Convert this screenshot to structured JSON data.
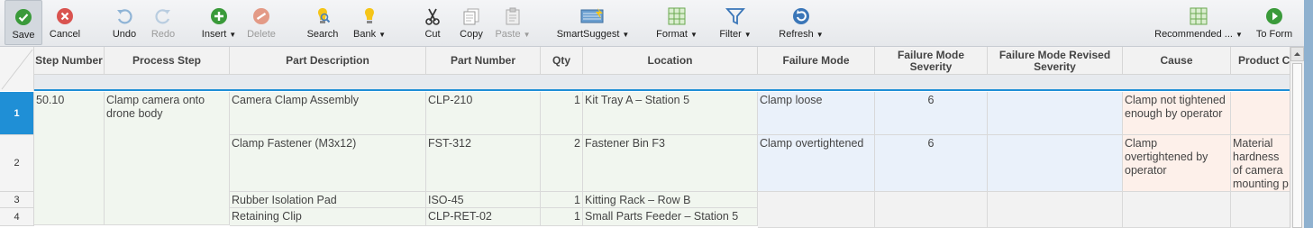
{
  "toolbar": {
    "save": "Save",
    "cancel": "Cancel",
    "undo": "Undo",
    "redo": "Redo",
    "insert": "Insert",
    "delete": "Delete",
    "search": "Search",
    "bank": "Bank",
    "cut": "Cut",
    "copy": "Copy",
    "paste": "Paste",
    "smartsuggest": "SmartSuggest",
    "format": "Format",
    "filter": "Filter",
    "refresh": "Refresh",
    "recommended": "Recommended ...",
    "to_form": "To Form"
  },
  "columns": {
    "step_number": "Step Number",
    "process_step": "Process Step",
    "part_description": "Part Description",
    "part_number": "Part Number",
    "qty": "Qty",
    "location": "Location",
    "failure_mode": "Failure Mode",
    "fm_severity": "Failure Mode Severity",
    "fm_revised_severity": "Failure Mode Revised Severity",
    "cause": "Cause",
    "product_char": "Product Character"
  },
  "rows": [
    {
      "num": "1",
      "step_number": "50.10",
      "process_step": "Clamp camera onto drone body",
      "part_description": "Camera Clamp Assembly",
      "part_number": "CLP-210",
      "qty": "1",
      "location": "Kit Tray A – Station 5",
      "failure_mode": "Clamp loose",
      "fm_severity": "6",
      "cause": "Clamp not tightened enough by operator",
      "product_char": ""
    },
    {
      "num": "2",
      "part_description": "Clamp Fastener (M3x12)",
      "part_number": "FST-312",
      "qty": "2",
      "location": "Fastener Bin F3",
      "failure_mode": "Clamp overtightened",
      "fm_severity": "6",
      "cause": "Clamp overtightened by operator",
      "product_char": "Material hardness of camera mounting p"
    },
    {
      "num": "3",
      "part_description": "Rubber Isolation Pad",
      "part_number": "ISO-45",
      "qty": "1",
      "location": "Kitting Rack – Row B"
    },
    {
      "num": "4",
      "part_description": "Retaining Clip",
      "part_number": "CLP-RET-02",
      "qty": "1",
      "location": "Small Parts Feeder – Station 5"
    }
  ],
  "icons": {
    "save": "check-circle-icon",
    "cancel": "x-circle-icon",
    "undo": "undo-icon",
    "redo": "redo-icon",
    "insert": "plus-circle-icon",
    "delete": "minus-circle-icon",
    "search": "search-bulb-icon",
    "bank": "lightbulb-icon",
    "cut": "scissors-icon",
    "copy": "copy-icon",
    "paste": "clipboard-icon",
    "smartsuggest": "smartsuggest-icon",
    "format": "format-grid-icon",
    "filter": "funnel-icon",
    "refresh": "refresh-icon",
    "recommended": "recommended-grid-icon",
    "to_form": "play-circle-icon"
  },
  "colors": {
    "selection": "#1f8fd6",
    "save_green": "#3a9a3a",
    "cancel_red": "#d9534f"
  }
}
